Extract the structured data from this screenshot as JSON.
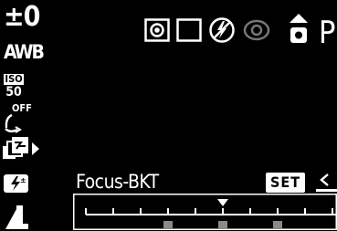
{
  "left_column": {
    "exposure_compensation": "±0",
    "white_balance": "AWB",
    "iso": {
      "label": "ISO",
      "value": "50"
    },
    "long_shutter": "OFF"
  },
  "mode": "P",
  "function_label": "Focus-BKT",
  "set_button_label": "SET",
  "bracket_scale": {
    "selected_index": 5,
    "marked_indices": [
      3,
      5,
      7
    ]
  },
  "icons": [
    "spot-metering-icon",
    "single-shot-drive-icon",
    "flash-off-icon",
    "red-eye-icon",
    "ae-lock-icon",
    "bracketing-icon",
    "flash-exposure-icon",
    "image-size-large-icon",
    "set-arrow-icon"
  ]
}
